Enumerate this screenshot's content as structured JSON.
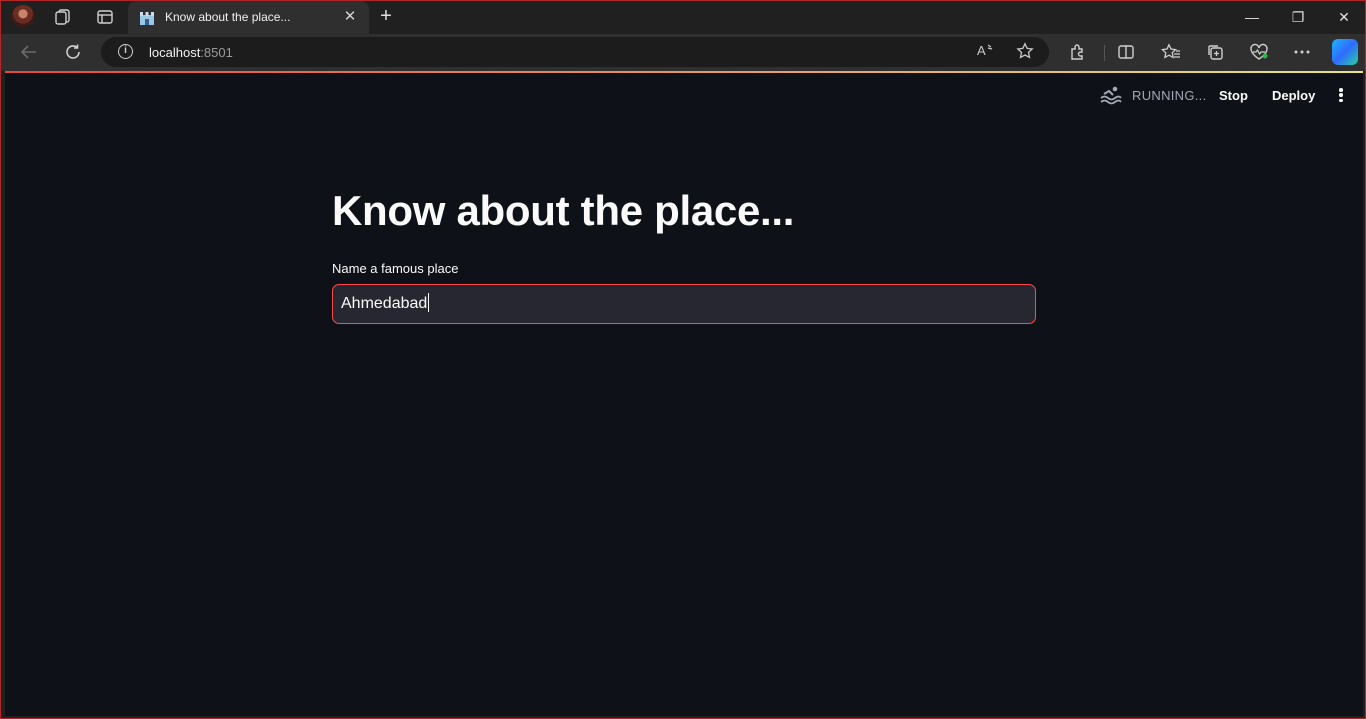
{
  "browser": {
    "tab": {
      "title": "Know about the place...",
      "close_icon": "close-icon"
    },
    "new_tab_label": "+",
    "address": {
      "host": "localhost",
      "port": ":8501"
    },
    "window_controls": {
      "minimize": "—",
      "restore": "❐",
      "close": "✕"
    },
    "toolbar_icons": [
      "back-icon",
      "refresh-icon",
      "read-aloud-icon",
      "favorite-star-icon",
      "extensions-icon",
      "split-screen-icon",
      "favorites-icon",
      "collections-icon",
      "browser-essentials-icon",
      "more-icon",
      "copilot-icon"
    ],
    "colors": {
      "frame_border": "#b3262a",
      "tab_active": "#2f2f2f"
    }
  },
  "app": {
    "header": {
      "status": "RUNNING...",
      "stop_label": "Stop",
      "deploy_label": "Deploy"
    },
    "title": "Know about the place...",
    "input": {
      "label": "Name a famous place",
      "value": "Ahmedabad"
    },
    "colors": {
      "background": "#0e1117",
      "accent": "#ff4b4b",
      "input_bg": "#262730"
    }
  }
}
